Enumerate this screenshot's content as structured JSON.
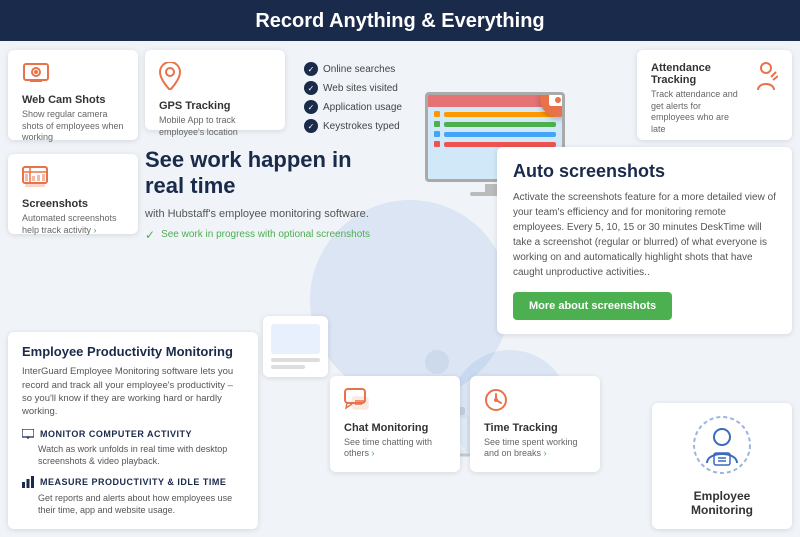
{
  "banner": {
    "title": "Record Anything & Everything"
  },
  "cards": {
    "webcam": {
      "title": "Web Cam Shots",
      "description": "Show regular camera shots of employees when working",
      "icon": "📷"
    },
    "gps": {
      "title": "GPS Tracking",
      "description": "Mobile App to track employee's location",
      "icon": "📍"
    },
    "checklist": {
      "items": [
        "Online searches",
        "Web sites visited",
        "Application usage",
        "Keystrokes typed"
      ]
    },
    "attendance": {
      "title": "Attendance Tracking",
      "description": "Track attendance and get alerts for employees who are late",
      "icon": "🏃"
    },
    "screenshots": {
      "title": "Screenshots",
      "description": "Automated screenshots help track activity",
      "link": "›",
      "icon": "🖥"
    },
    "chat": {
      "title": "Chat Monitoring",
      "description": "See time chatting with others",
      "link": "›",
      "icon": "💬"
    },
    "time": {
      "title": "Time Tracking",
      "description": "See time spent working and on breaks",
      "link": "›",
      "icon": "⏱"
    },
    "employee_monitoring": {
      "title": "Employee Monitoring",
      "icon": "👤"
    }
  },
  "realtime": {
    "heading": "See work happen in real time",
    "subtext": "with Hubstaff's employee monitoring software.",
    "check_text": "See work in progress with optional screenshots"
  },
  "auto_screenshots": {
    "title": "Auto screenshots",
    "description": "Activate the screenshots feature for a more detailed view of your team's efficiency and for monitoring remote employees. Every 5, 10, 15 or 30 minutes DeskTime will take a screenshot (regular or blurred) of what everyone is working on and automatically highlight shots that have caught unproductive activities..",
    "button_label": "More about screenshots"
  },
  "productivity": {
    "title": "Employee Productivity Monitoring",
    "description": "InterGuard Employee Monitoring software lets you record and track all your employee's productivity – so you'll know if they are working hard or hardly working.",
    "monitor_title": "MONITOR COMPUTER ACTIVITY",
    "monitor_desc": "Watch as work unfolds in real time with desktop screenshots & video playback.",
    "measure_title": "MEASURE PRODUCTIVITY & IDLE TIME",
    "measure_desc": "Get reports and alerts about how employees use their time, app and website usage."
  },
  "icons": {
    "webcam": "▣",
    "gps": "◎",
    "attendance": "♟",
    "screenshots": "▤",
    "chat": "◫",
    "time": "◷",
    "employee": "◉",
    "monitor_activity": "🖥",
    "measure": "📊"
  }
}
